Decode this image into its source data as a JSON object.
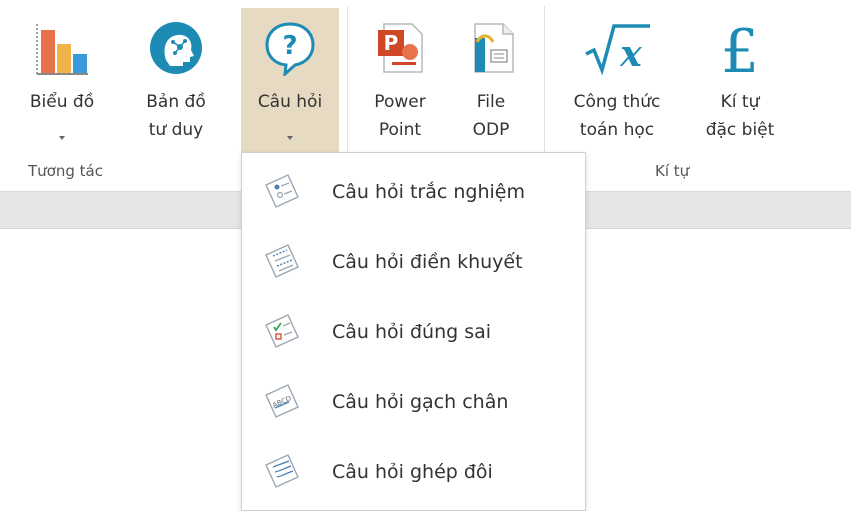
{
  "ribbon": {
    "buttons": [
      {
        "label": "Biểu đồ",
        "icon": "bar-chart-icon"
      },
      {
        "label": "Bản đồ\ntư duy",
        "icon": "mind-map-icon"
      },
      {
        "label": "Câu hỏi",
        "icon": "question-icon"
      },
      {
        "label": "Power\nPoint",
        "icon": "powerpoint-icon"
      },
      {
        "label": "File\nODP",
        "icon": "odp-file-icon"
      },
      {
        "label": "Công thức\ntoán học",
        "icon": "sqrt-x-icon"
      },
      {
        "label": "Kí tự\nđặc biệt",
        "icon": "pound-sign-icon"
      }
    ],
    "groups": [
      "Tương tác",
      "Kí tự"
    ]
  },
  "dropdown": {
    "items": [
      {
        "label": "Câu hỏi trắc nghiệm",
        "icon": "multiple-choice-icon"
      },
      {
        "label": "Câu hỏi điền khuyết",
        "icon": "fill-blank-icon"
      },
      {
        "label": "Câu hỏi đúng sai",
        "icon": "true-false-icon"
      },
      {
        "label": "Câu hỏi gạch chân",
        "icon": "underline-question-icon"
      },
      {
        "label": "Câu hỏi ghép đôi",
        "icon": "matching-icon"
      }
    ]
  },
  "colors": {
    "active_bg": "#e6dac2",
    "teal": "#1e8bb5",
    "accent_orange": "#e8734a",
    "ppt_red": "#d04727",
    "band": "#e6e6e6"
  }
}
